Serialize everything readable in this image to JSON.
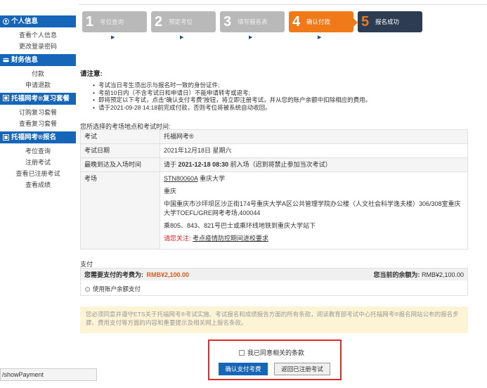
{
  "sidebar": {
    "personal": {
      "title": "个人信息",
      "items": [
        "查看个人信息",
        "更改登录密码"
      ]
    },
    "finance": {
      "title": "财务信息",
      "items": [
        "付款",
        "申请退款"
      ]
    },
    "review": {
      "title": "托福网考®复习套餐",
      "items": [
        "订购复习套餐",
        "查看复习套餐"
      ]
    },
    "register": {
      "title": "托福网考®报名",
      "items": [
        "考位查询",
        "注册考试",
        "查看已注册考试",
        "查看成绩"
      ]
    }
  },
  "steps": [
    {
      "num": "1",
      "label": "考位查询",
      "state": "done"
    },
    {
      "num": "2",
      "label": "预定考位",
      "state": "done"
    },
    {
      "num": "3",
      "label": "填写报名表",
      "state": "done"
    },
    {
      "num": "4",
      "label": "确认付款",
      "state": "current"
    },
    {
      "num": "5",
      "label": "报名成功",
      "state": "next"
    }
  ],
  "notice": {
    "title": "请注意:",
    "items": [
      "考试当日考生须出示与报名时一致的身份证件;",
      "考前10日内（不含考试日和申请日）不能申请转考或退考;",
      "即将预定以下考试，点击“确认支付考费”按钮，将立即注册考试，并从您的账户余额中扣除相应的费用。",
      "请于2021-09-28 14:18前完成付款，否则考位将被系统自动收回。"
    ]
  },
  "exam": {
    "caption": "您所选择的考场地点和考试时间:",
    "rows": {
      "test_label": "考试",
      "test_value": "托福网考®",
      "date_label": "考试日期",
      "date_value": "2021年12月18日 星期六",
      "arrive_label": "最晚到达及入场时间",
      "arrive_prefix": "请于",
      "arrive_time": "2021-12-18 08:30",
      "arrive_suffix": "前入场（迟到将禁止参加当次考试）",
      "venue_label": "考场",
      "venue_code": "STN80060A",
      "venue_name": "重庆大学",
      "venue_city": "重庆",
      "venue_address": "中国重庆市沙坪坝区沙正街174号重庆大学A区公共管理学院办公楼（人文社会科学逸夫楼）306/308室重庆大学TOEFL/GRE网考考场,400044",
      "venue_bus": "乘805、843、821号巴士或乘环线地铁到重庆大学站下",
      "venue_note_prefix": "请您关注:",
      "venue_note_link": "考点疫情防控期间进校要求"
    }
  },
  "payment": {
    "caption": "支付",
    "fee_label": "您需要支付的考费为:",
    "fee_value": "RMB¥2,100.00",
    "balance_label": "您当前的余额为:",
    "balance_value": "RMB¥2,100.00",
    "method": "使用账户余额支付"
  },
  "agreement": {
    "text": "您必须同意并遵守ETS关于托福网考®考试实施、考试报名和成绩报告方面的所有条款，阅读教育部考试中心托福网考®报名网站公布的报名步骤、费用支付等方面的内容和重要提示及相关网上报名条款。"
  },
  "consent_label": "我已同意相关的条款",
  "buttons": {
    "confirm": "确认支付考费",
    "back": "返回已注册考试"
  },
  "status_url": "/showPayment",
  "colors": {
    "primary": "#1565b8",
    "accent_orange": "#f07a1a",
    "dark_step": "#2d3c52",
    "warning_red": "#d92020",
    "highlight_frame": "#e22a2a"
  }
}
